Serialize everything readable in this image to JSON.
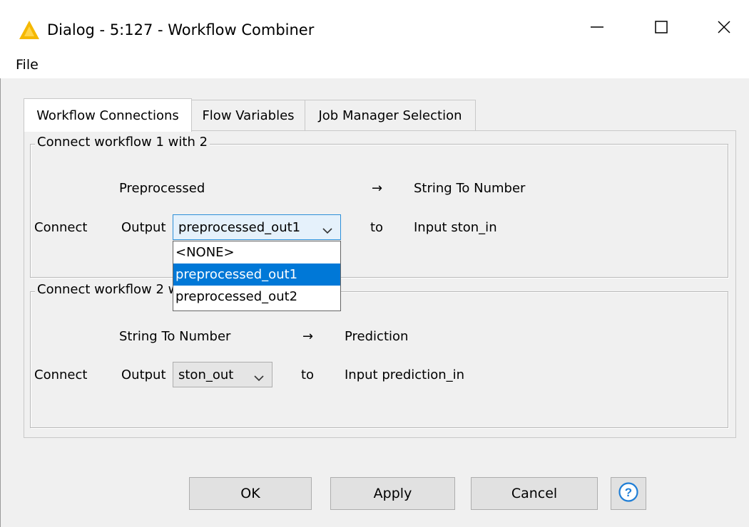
{
  "window": {
    "title": "Dialog - 5:127 - Workflow Combiner",
    "app_icon": "knime-triangle-icon",
    "icon_color": "#f5b800",
    "controls": {
      "minimize": "minimize-icon",
      "maximize": "maximize-icon",
      "close": "close-icon"
    }
  },
  "menubar": {
    "file_label": "File"
  },
  "tabs": [
    {
      "label": "Workflow Connections",
      "active": true
    },
    {
      "label": "Flow Variables",
      "active": false
    },
    {
      "label": "Job Manager Selection",
      "active": false
    }
  ],
  "group1": {
    "title": "Connect workflow 1 with 2",
    "source_workflow": "Preprocessed",
    "arrow": "→",
    "target_workflow": "String To Number",
    "connect_label": "Connect",
    "output_label": "Output",
    "output_selected": "preprocessed_out1",
    "to_label": "to",
    "input_label": "Input ston_in",
    "dropdown_options": [
      "<NONE>",
      "preprocessed_out1",
      "preprocessed_out2"
    ]
  },
  "group2": {
    "title": "Connect workflow 2 with 3",
    "source_workflow": "String To Number",
    "arrow": "→",
    "target_workflow": "Prediction",
    "connect_label": "Connect",
    "output_label": "Output",
    "output_selected": "ston_out",
    "to_label": "to",
    "input_label": "Input prediction_in"
  },
  "buttons": {
    "ok": "OK",
    "apply": "Apply",
    "cancel": "Cancel",
    "help_icon": "help-icon"
  },
  "colors": {
    "selection": "#0078d7",
    "focus_border": "#2c8fd8",
    "help_blue": "#1f7ed6"
  }
}
